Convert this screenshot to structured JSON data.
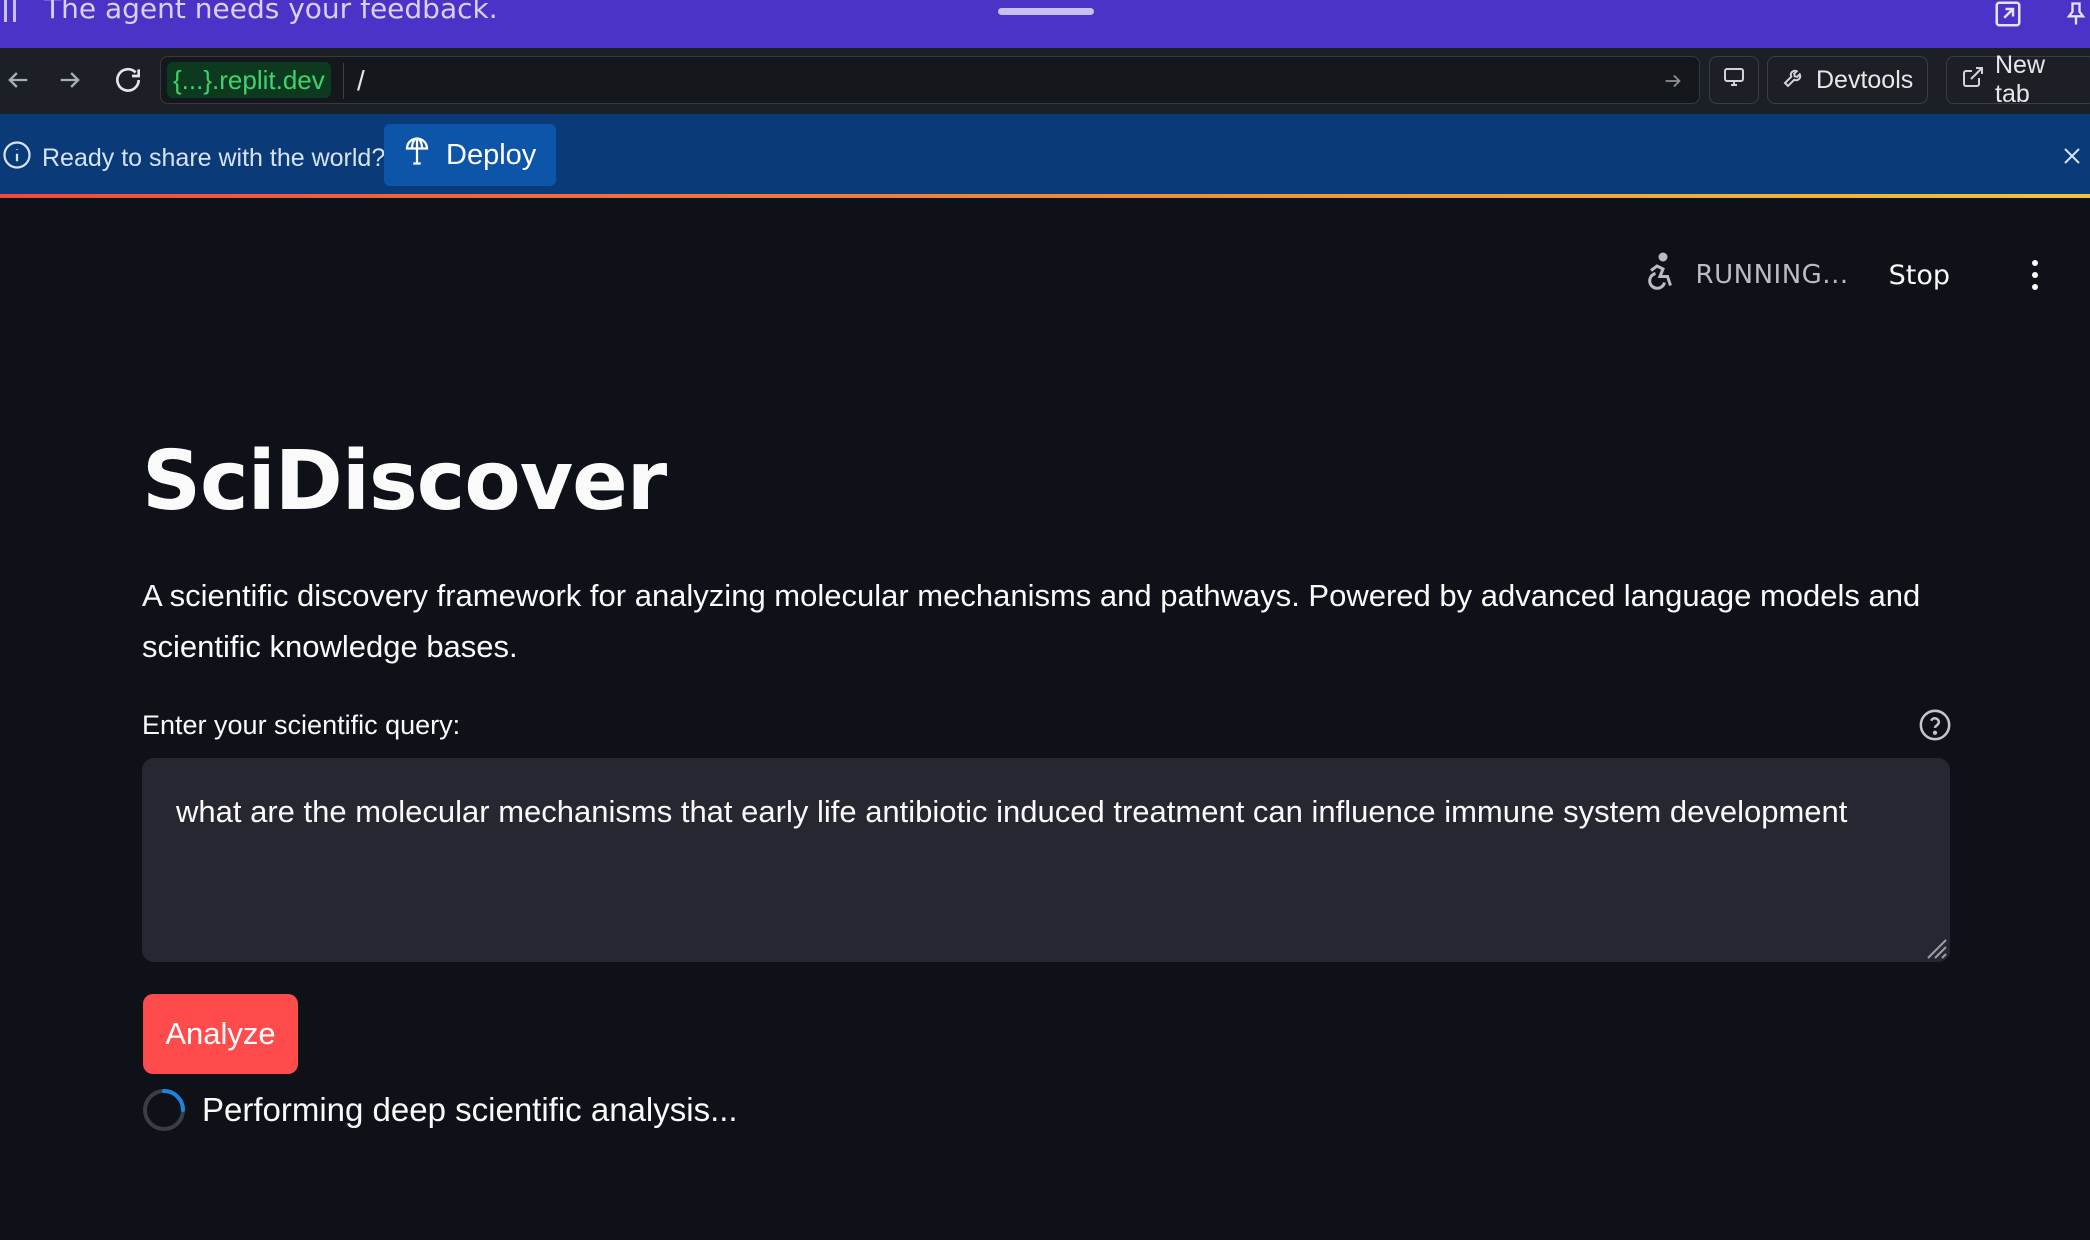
{
  "agent_bar": {
    "message": "The agent needs your feedback.",
    "icons": [
      "drag-grip-icon",
      "expand-icon",
      "pin-icon"
    ]
  },
  "browser": {
    "url_host": "{...}.replit.dev",
    "url_path": "/",
    "devtools_label": "Devtools",
    "new_tab_label": "New tab",
    "icons": [
      "back-arrow-icon",
      "forward-arrow-icon",
      "reload-icon",
      "go-arrow-icon",
      "screen-icon",
      "wrench-icon",
      "external-link-icon"
    ]
  },
  "deploy_banner": {
    "info_text": "Ready to share with the world?",
    "deploy_label": "Deploy",
    "icons": [
      "info-icon",
      "deploy-icon",
      "close-icon"
    ]
  },
  "app": {
    "status": "RUNNING...",
    "stop_label": "Stop",
    "title": "SciDiscover",
    "description": "A scientific discovery framework for analyzing molecular mechanisms and pathways. Powered by advanced language models and scientific knowledge bases.",
    "query_label": "Enter your scientific query:",
    "query_value": "what are the molecular mechanisms that early life antibiotic induced treatment can influence immune system development",
    "analyze_label": "Analyze",
    "spinner_text": "Performing deep scientific analysis..."
  },
  "colors": {
    "agent_bar": "#4b33c7",
    "deploy_bar": "#0a3a78",
    "deploy_button": "#0d55a8",
    "background": "#0e1117",
    "input_bg": "#262730",
    "primary_button": "#ff4b4b",
    "url_host": "#3fd26e"
  }
}
